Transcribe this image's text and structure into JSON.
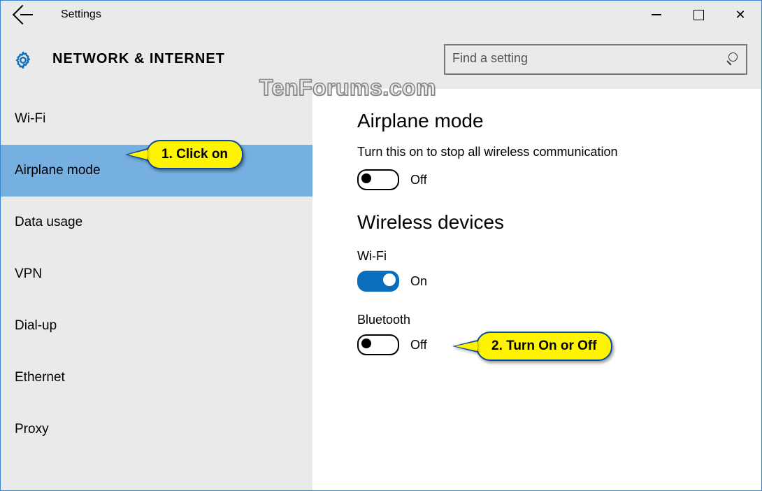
{
  "window": {
    "title": "Settings"
  },
  "header": {
    "section": "NETWORK & INTERNET",
    "search_placeholder": "Find a setting"
  },
  "sidebar": {
    "items": [
      {
        "label": "Wi-Fi",
        "name": "sidebar-item-wifi"
      },
      {
        "label": "Airplane mode",
        "name": "sidebar-item-airplane-mode",
        "selected": true
      },
      {
        "label": "Data usage",
        "name": "sidebar-item-data-usage"
      },
      {
        "label": "VPN",
        "name": "sidebar-item-vpn"
      },
      {
        "label": "Dial-up",
        "name": "sidebar-item-dial-up"
      },
      {
        "label": "Ethernet",
        "name": "sidebar-item-ethernet"
      },
      {
        "label": "Proxy",
        "name": "sidebar-item-proxy"
      }
    ]
  },
  "content": {
    "airplane": {
      "heading": "Airplane mode",
      "description": "Turn this on to stop all wireless communication",
      "toggle_state": "Off"
    },
    "wireless": {
      "heading": "Wireless devices",
      "wifi": {
        "label": "Wi-Fi",
        "state": "On"
      },
      "bluetooth": {
        "label": "Bluetooth",
        "state": "Off"
      }
    }
  },
  "callouts": {
    "c1": "1. Click on",
    "c2": "2. Turn On or Off"
  },
  "watermark": "TenForums.com"
}
